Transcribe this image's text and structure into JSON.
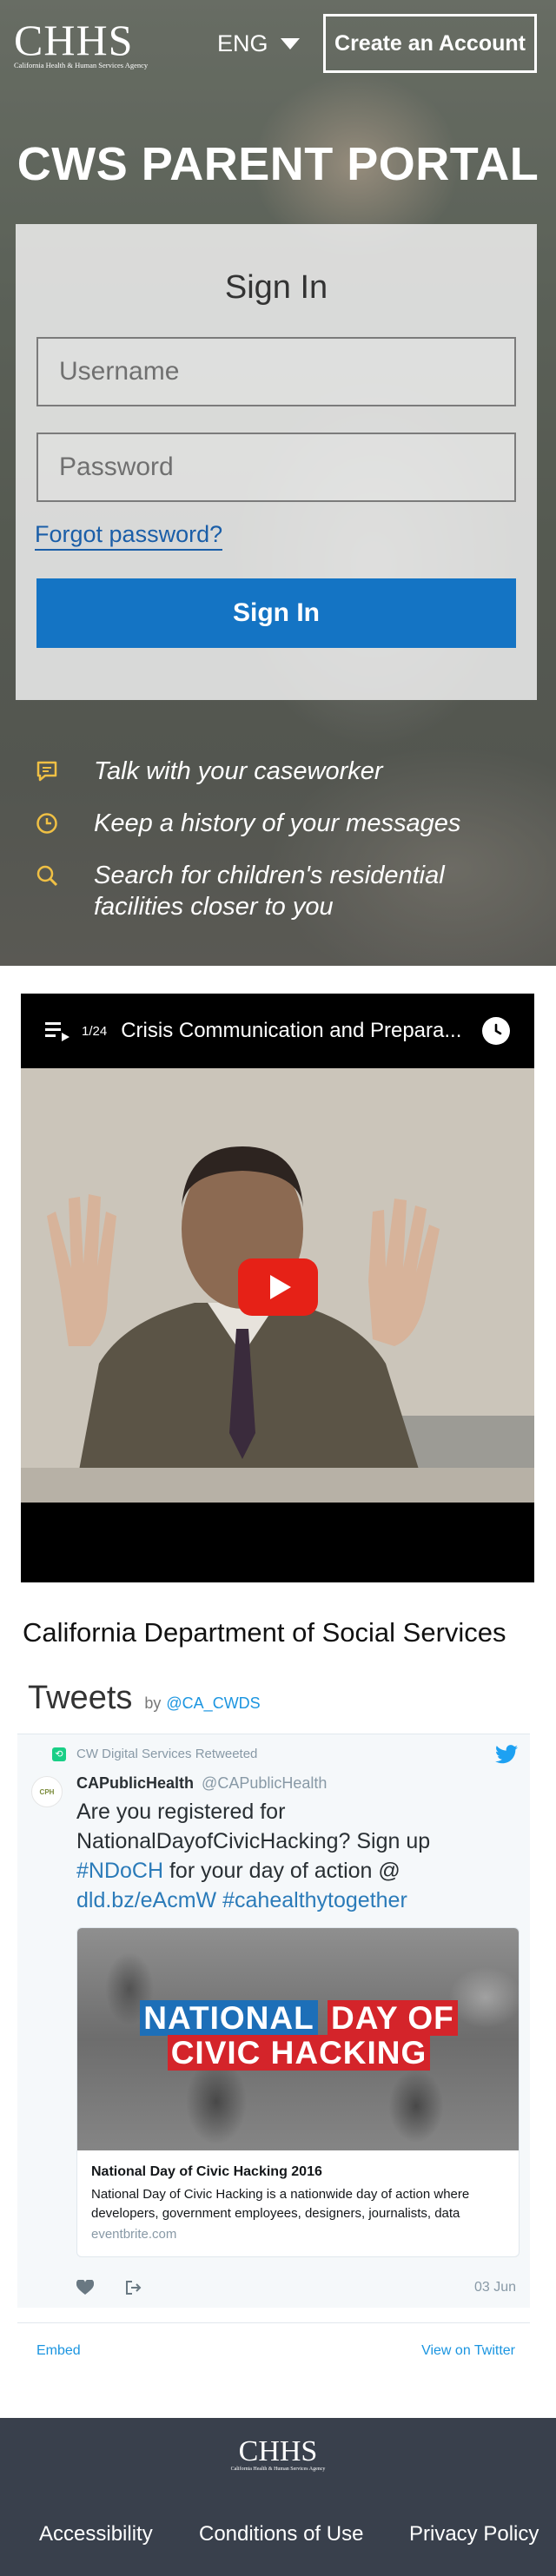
{
  "header": {
    "logo_mark": "CHHS",
    "logo_sub": "California Health & Human Services Agency",
    "language": "ENG",
    "create_account": "Create an Account"
  },
  "hero": {
    "title": "CWS PARENT PORTAL",
    "features": [
      {
        "icon": "chat-bubble-icon",
        "text": "Talk with your caseworker"
      },
      {
        "icon": "clock-icon",
        "text": "Keep a history of your messages"
      },
      {
        "icon": "search-icon",
        "text": "Search for children's residential facilities closer to you"
      }
    ],
    "accent_icon_color": "#f0c044"
  },
  "signin": {
    "title": "Sign In",
    "username_placeholder": "Username",
    "password_placeholder": "Password",
    "forgot": "Forgot password?",
    "button": "Sign In",
    "button_color": "#1474c4"
  },
  "video": {
    "playlist_count": "1/24",
    "title": "Crisis Communication and Prepara...",
    "play_color": "#e62117"
  },
  "dss_heading": "California Department of Social Services",
  "tweets": {
    "title": "Tweets",
    "by": "by",
    "handle": "@CA_CWDS",
    "retweet_label": "CW Digital Services Retweeted",
    "avatar_text": "CPH",
    "author_name": "CAPublicHealth",
    "author_handle": "@CAPublicHealth",
    "text_1": "Are you registered for NationalDayofCivicHacking? Sign up ",
    "link_1": "#NDoCH",
    "text_2": " for your day of action @ ",
    "link_2": "dld.bz/eAcmW",
    "link_3": "#cahealthytogether",
    "card": {
      "banner_line1_a": "NATIONAL",
      "banner_line1_b": "DAY OF",
      "banner_line2": "CIVIC HACKING",
      "title": "National Day of Civic Hacking 2016",
      "description": "National Day of Civic Hacking is a nationwide day of action where developers, government employees, designers, journalists, data",
      "domain": "eventbrite.com"
    },
    "date": "03 Jun",
    "embed": "Embed",
    "view_on_twitter": "View on Twitter",
    "link_color": "#1b95e0"
  },
  "footer": {
    "logo_mark": "CHHS",
    "logo_sub": "California Health & Human Services Agency",
    "links": [
      "Accessibility",
      "Conditions of Use",
      "Privacy Policy"
    ]
  }
}
